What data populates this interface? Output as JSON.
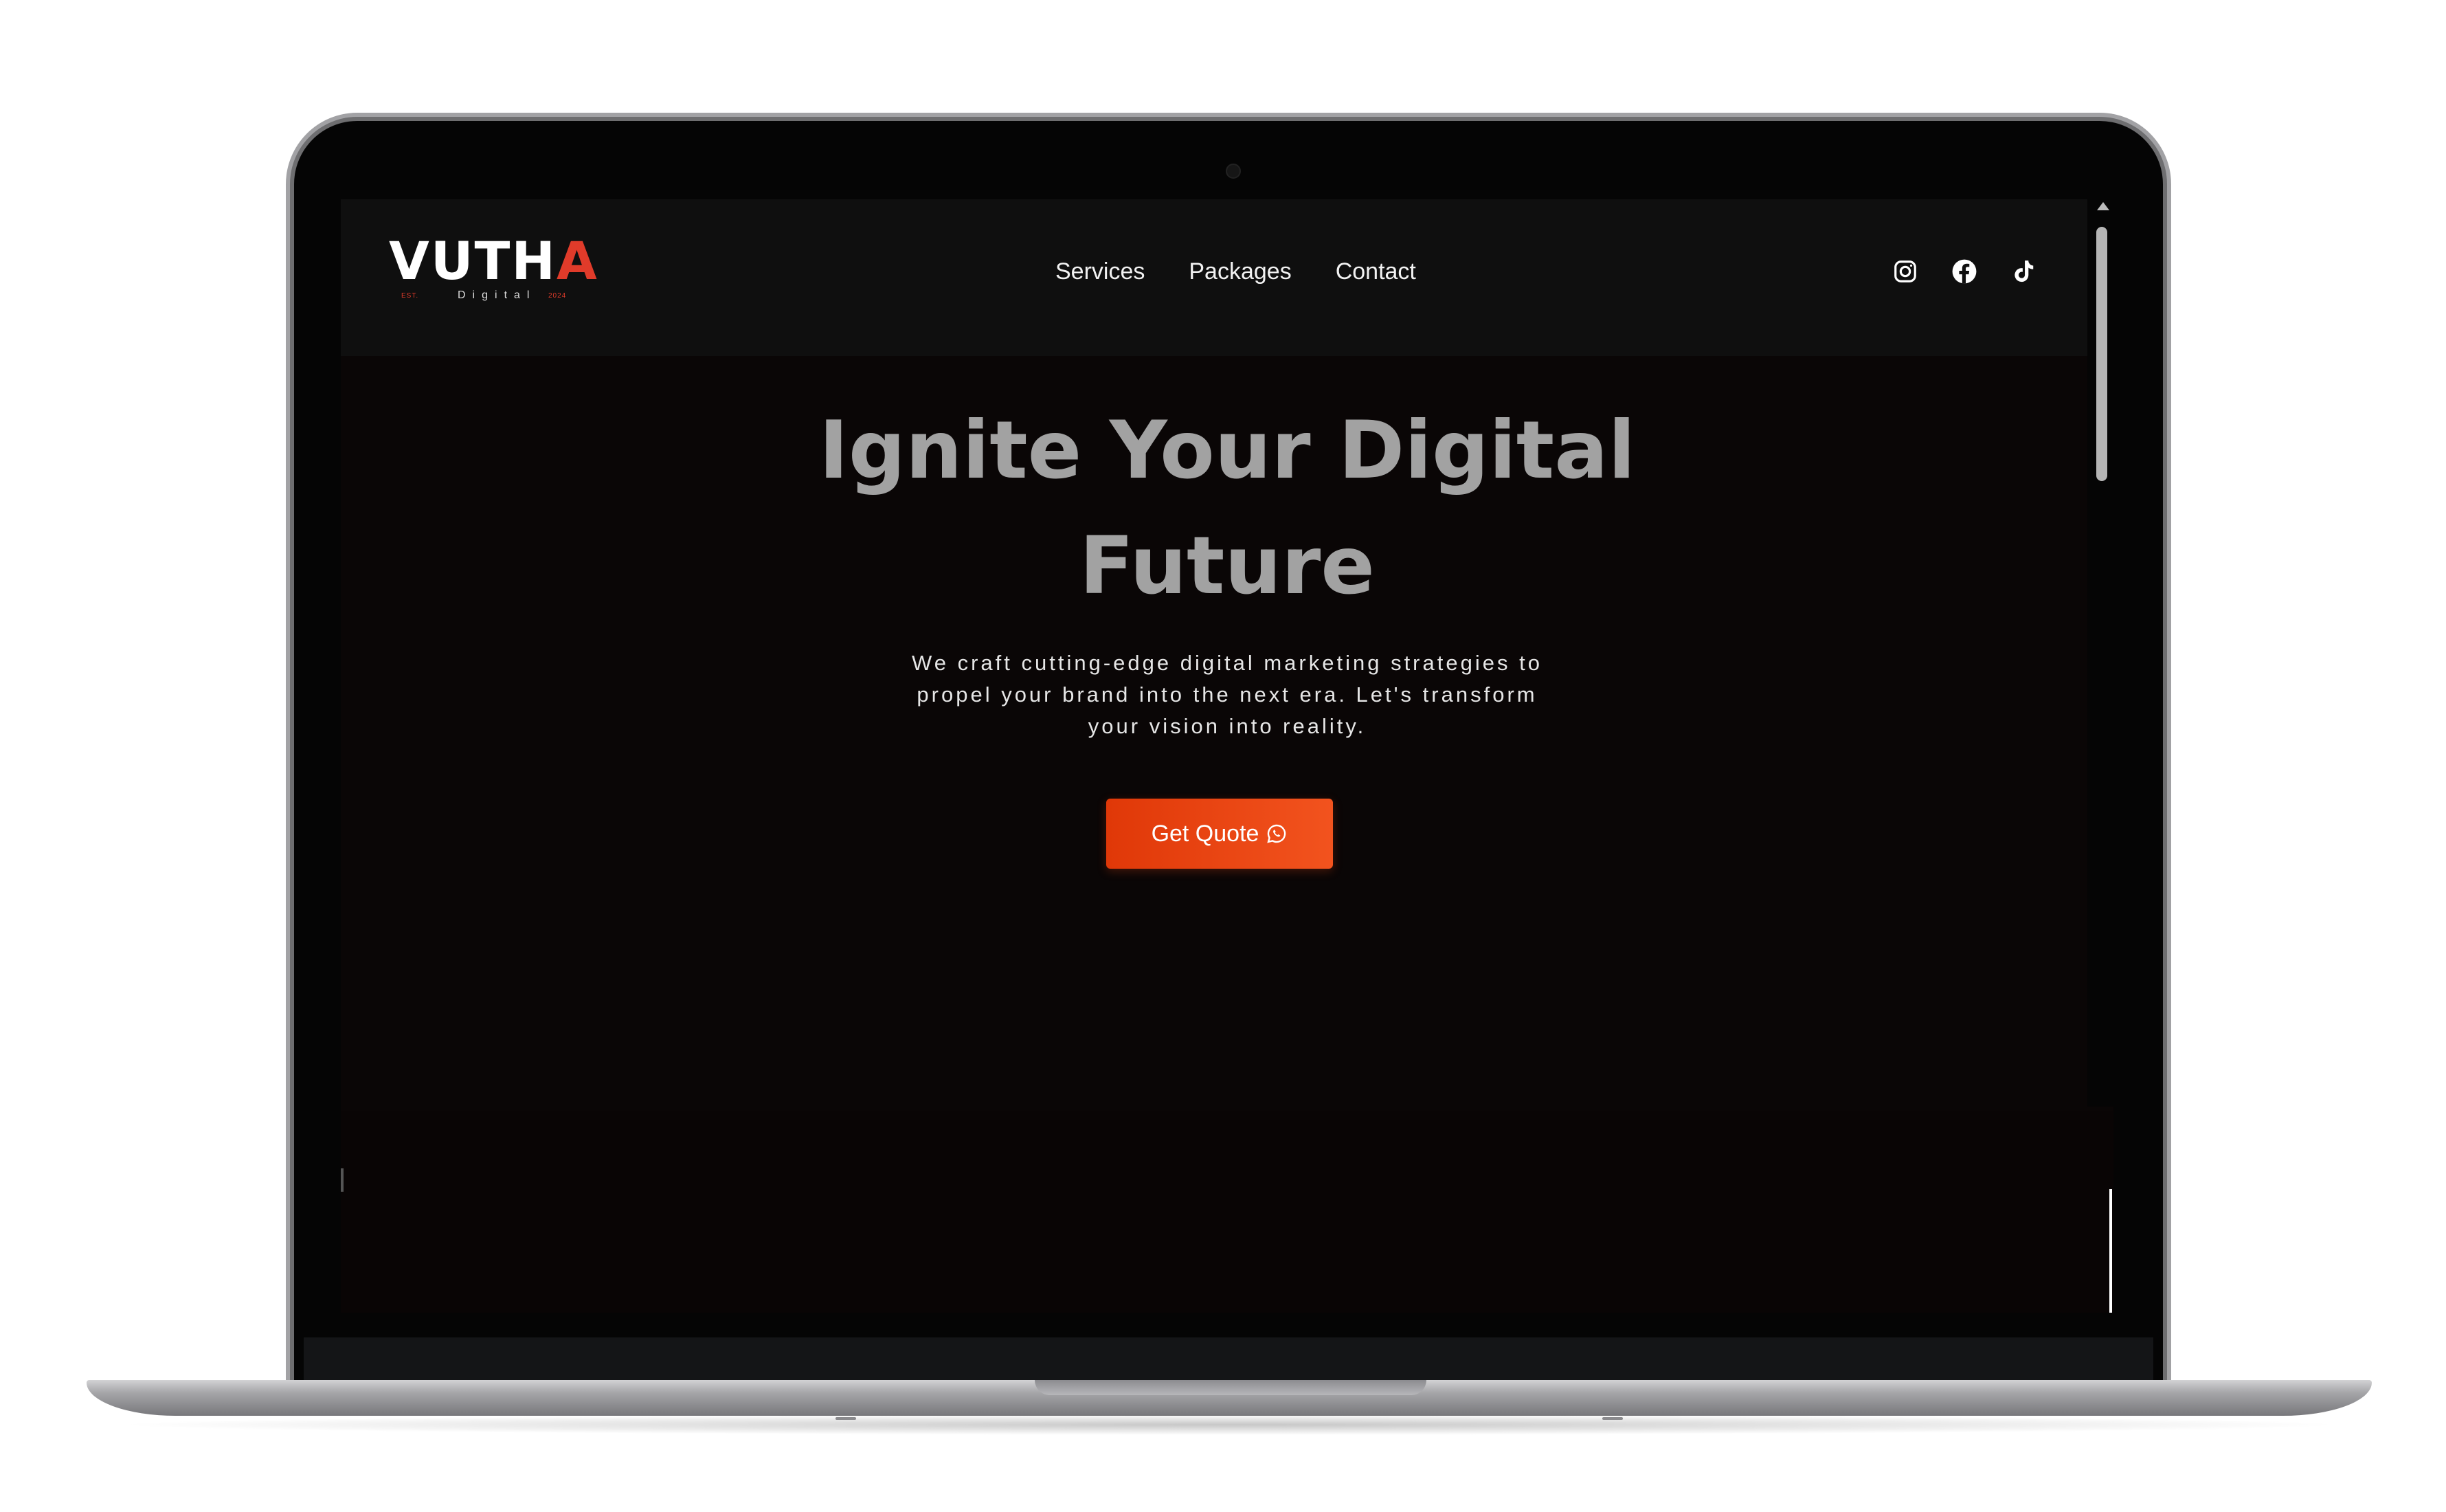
{
  "brand": {
    "name_main": "VUTH",
    "name_accent": "A",
    "tagline": "Digital",
    "est_left": "EST.",
    "est_right": "2024"
  },
  "nav": {
    "links": [
      "Services",
      "Packages",
      "Contact"
    ]
  },
  "socials": [
    "instagram-icon",
    "facebook-icon",
    "tiktok-icon"
  ],
  "hero": {
    "title_line1": "Ignite Your Digital",
    "title_line2": "Future",
    "description_lines": [
      "We craft cutting-edge digital marketing strategies to",
      "propel your brand into the next era. Let's transform",
      "your vision into reality."
    ],
    "cta_label": "Get Quote",
    "cta_icon": "whatsapp-icon"
  },
  "colors": {
    "accent": "#e03b2a",
    "cta": "#f04a18",
    "background": "#0a0606",
    "navbar": "#0f0f0f"
  }
}
